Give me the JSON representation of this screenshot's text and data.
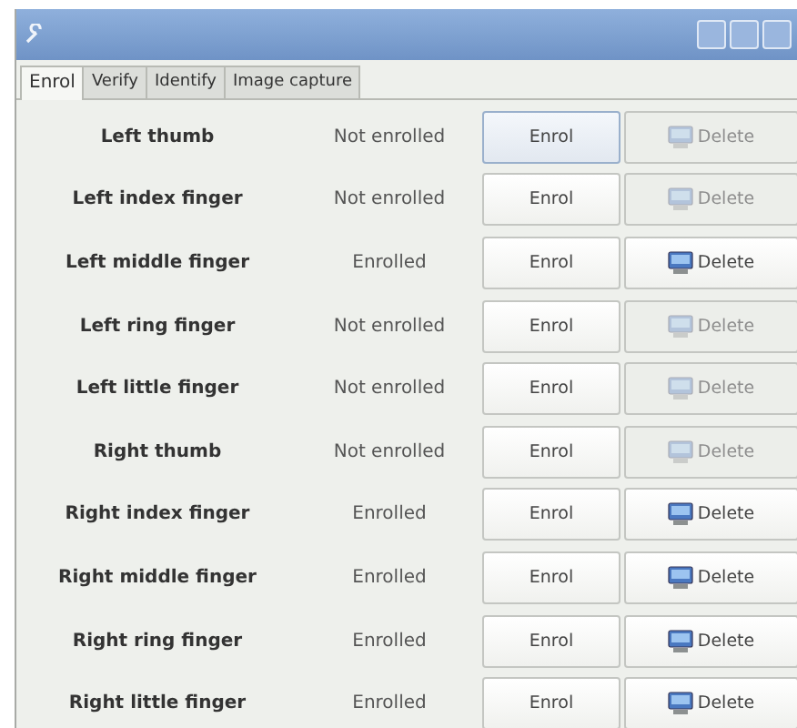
{
  "tabs": [
    {
      "label": "Enrol",
      "selected": true
    },
    {
      "label": "Verify",
      "selected": false
    },
    {
      "label": "Identify",
      "selected": false
    },
    {
      "label": "Image capture",
      "selected": false
    }
  ],
  "fingers": [
    {
      "name": "Left thumb",
      "status": "Not enrolled",
      "enrol": "Enrol",
      "delete": "Delete",
      "enrol_focused": true,
      "delete_disabled": true
    },
    {
      "name": "Left index finger",
      "status": "Not enrolled",
      "enrol": "Enrol",
      "delete": "Delete",
      "enrol_focused": false,
      "delete_disabled": true
    },
    {
      "name": "Left middle finger",
      "status": "Enrolled",
      "enrol": "Enrol",
      "delete": "Delete",
      "enrol_focused": false,
      "delete_disabled": false
    },
    {
      "name": "Left ring finger",
      "status": "Not enrolled",
      "enrol": "Enrol",
      "delete": "Delete",
      "enrol_focused": false,
      "delete_disabled": true
    },
    {
      "name": "Left little finger",
      "status": "Not enrolled",
      "enrol": "Enrol",
      "delete": "Delete",
      "enrol_focused": false,
      "delete_disabled": true
    },
    {
      "name": "Right thumb",
      "status": "Not enrolled",
      "enrol": "Enrol",
      "delete": "Delete",
      "enrol_focused": false,
      "delete_disabled": true
    },
    {
      "name": "Right index finger",
      "status": "Enrolled",
      "enrol": "Enrol",
      "delete": "Delete",
      "enrol_focused": false,
      "delete_disabled": false
    },
    {
      "name": "Right middle finger",
      "status": "Enrolled",
      "enrol": "Enrol",
      "delete": "Delete",
      "enrol_focused": false,
      "delete_disabled": false
    },
    {
      "name": "Right ring finger",
      "status": "Enrolled",
      "enrol": "Enrol",
      "delete": "Delete",
      "enrol_focused": false,
      "delete_disabled": false
    },
    {
      "name": "Right little finger",
      "status": "Enrolled",
      "enrol": "Enrol",
      "delete": "Delete",
      "enrol_focused": false,
      "delete_disabled": false
    }
  ]
}
